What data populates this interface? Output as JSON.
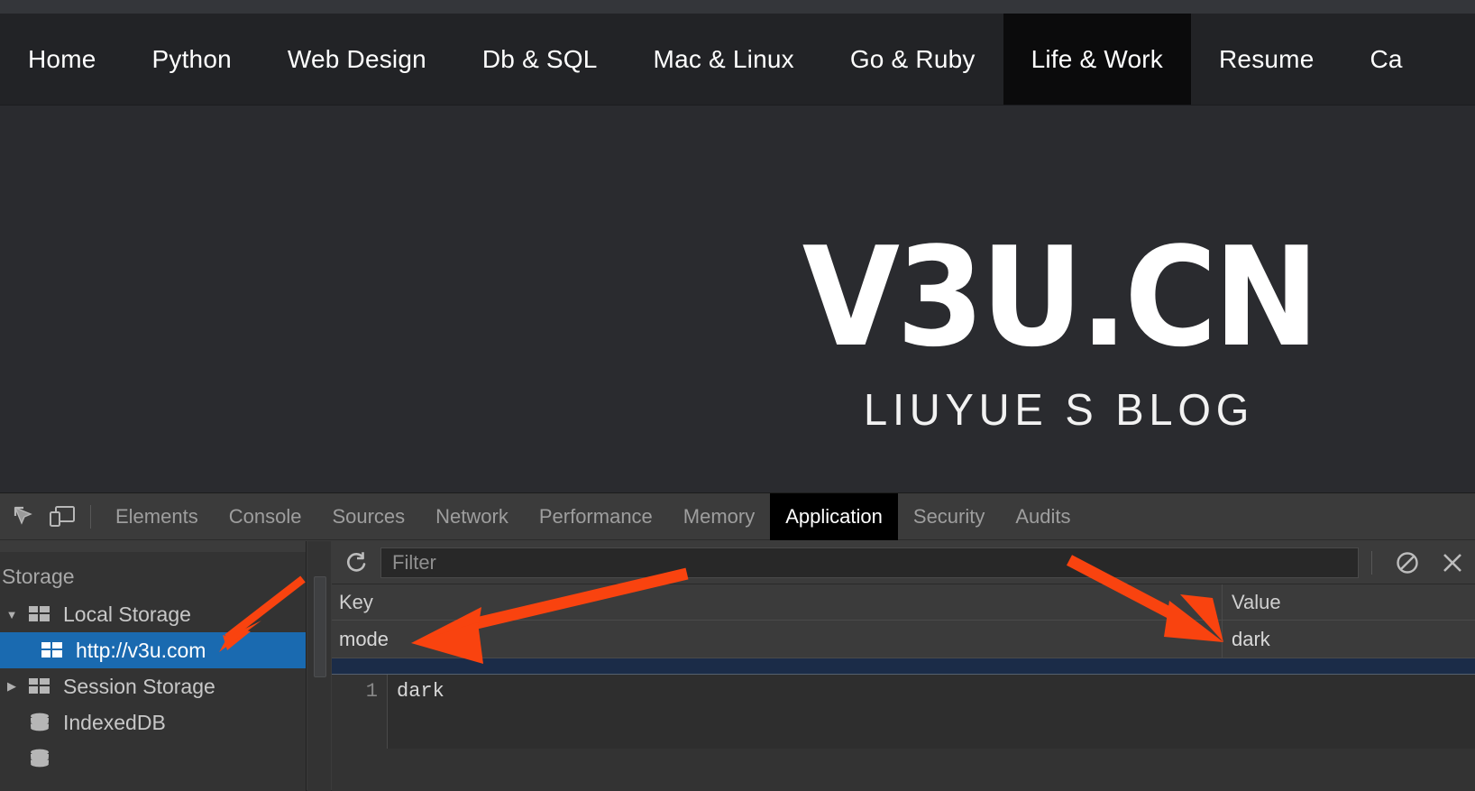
{
  "site_nav": {
    "items": [
      {
        "label": "Home",
        "active": false
      },
      {
        "label": "Python",
        "active": false
      },
      {
        "label": "Web Design",
        "active": false
      },
      {
        "label": "Db & SQL",
        "active": false
      },
      {
        "label": "Mac & Linux",
        "active": false
      },
      {
        "label": "Go & Ruby",
        "active": false
      },
      {
        "label": "Life & Work",
        "active": true
      },
      {
        "label": "Resume",
        "active": false
      },
      {
        "label": "Ca",
        "active": false
      }
    ]
  },
  "site_body": {
    "logo_main": "V3U.CN",
    "logo_sub": "LIUYUE S BLOG"
  },
  "devtools": {
    "left_icons": [
      {
        "name": "inspect-element-icon"
      },
      {
        "name": "device-toolbar-icon"
      }
    ],
    "tabs": [
      {
        "label": "Elements",
        "active": false
      },
      {
        "label": "Console",
        "active": false
      },
      {
        "label": "Sources",
        "active": false
      },
      {
        "label": "Network",
        "active": false
      },
      {
        "label": "Performance",
        "active": false
      },
      {
        "label": "Memory",
        "active": false
      },
      {
        "label": "Application",
        "active": true
      },
      {
        "label": "Security",
        "active": false
      },
      {
        "label": "Audits",
        "active": false
      }
    ],
    "sidebar": {
      "section_title": "Storage",
      "items": [
        {
          "label": "Local Storage",
          "twisty": "▼",
          "icon": "table-grid-icon",
          "indent": 0,
          "selected": false
        },
        {
          "label": "http://v3u.com",
          "twisty": "",
          "icon": "table-grid-icon",
          "indent": 1,
          "selected": true
        },
        {
          "label": "Session Storage",
          "twisty": "▶",
          "icon": "table-grid-icon",
          "indent": 0,
          "selected": false
        },
        {
          "label": "IndexedDB",
          "twisty": "",
          "icon": "database-icon",
          "indent": 0,
          "selected": false
        }
      ]
    },
    "toolbar": {
      "refresh_icon": "refresh-icon",
      "filter_placeholder": "Filter",
      "filter_value": "",
      "clear_all_icon": "clear-all-icon",
      "delete_selected_icon": "delete-selected-icon"
    },
    "grid": {
      "columns": [
        "Key",
        "Value"
      ],
      "rows": [
        {
          "key": "mode",
          "value": "dark"
        }
      ]
    },
    "preview": {
      "line_number": "1",
      "content": "dark"
    }
  },
  "annotations": {
    "accent_color": "#f9430f",
    "arrows": [
      {
        "name": "arrow-to-local-storage"
      },
      {
        "name": "arrow-to-key-mode"
      },
      {
        "name": "arrow-to-value-dark"
      }
    ]
  },
  "colors": {
    "page_bg": "#2a2b2f",
    "nav_bg": "#222326",
    "nav_active_bg": "#0b0b0c",
    "devtools_bg": "#3b3b3b",
    "panel_bg": "#333333",
    "selection_blue": "#1a6ab0",
    "split_navy": "#1b2c48",
    "accent": "#f9430f"
  }
}
